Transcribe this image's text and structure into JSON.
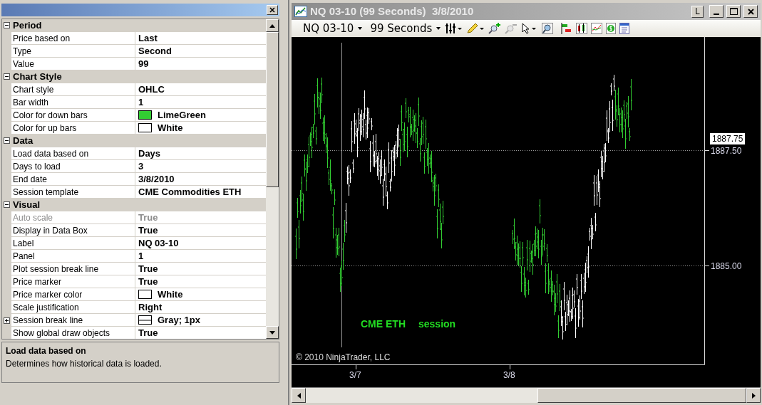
{
  "properties_panel": {
    "categories": [
      {
        "name": "Period",
        "expanded": true,
        "items": [
          {
            "kind": "text",
            "name": "Price based on",
            "value": "Last"
          },
          {
            "kind": "text",
            "name": "Type",
            "value": "Second"
          },
          {
            "kind": "text",
            "name": "Value",
            "value": "99"
          }
        ]
      },
      {
        "name": "Chart Style",
        "expanded": true,
        "items": [
          {
            "kind": "text",
            "name": "Chart style",
            "value": "OHLC"
          },
          {
            "kind": "text",
            "name": "Bar width",
            "value": "1"
          },
          {
            "kind": "color",
            "name": "Color for down bars",
            "value": "LimeGreen",
            "color": "#32cd32"
          },
          {
            "kind": "color",
            "name": "Color for up bars",
            "value": "White",
            "color": "#ffffff"
          }
        ]
      },
      {
        "name": "Data",
        "expanded": true,
        "items": [
          {
            "kind": "text",
            "name": "Load data based on",
            "value": "Days"
          },
          {
            "kind": "text",
            "name": "Days to load",
            "value": "3"
          },
          {
            "kind": "text",
            "name": "End date",
            "value": "3/8/2010"
          },
          {
            "kind": "text",
            "name": "Session template",
            "value": "CME Commodities ETH"
          }
        ]
      },
      {
        "name": "Visual",
        "expanded": true,
        "items": [
          {
            "kind": "text",
            "name": "Auto scale",
            "value": "True",
            "disabled": true
          },
          {
            "kind": "text",
            "name": "Display in Data Box",
            "value": "True"
          },
          {
            "kind": "text",
            "name": "Label",
            "value": "NQ 03-10"
          },
          {
            "kind": "text",
            "name": "Panel",
            "value": "1"
          },
          {
            "kind": "text",
            "name": "Plot session break line",
            "value": "True"
          },
          {
            "kind": "text",
            "name": "Price marker",
            "value": "True"
          },
          {
            "kind": "color",
            "name": "Price marker color",
            "value": "White",
            "color": "#ffffff"
          },
          {
            "kind": "text",
            "name": "Scale justification",
            "value": "Right"
          },
          {
            "kind": "line",
            "name": "Session break line",
            "value": "Gray; 1px",
            "expanded": false
          },
          {
            "kind": "text",
            "name": "Show global draw objects",
            "value": "True"
          }
        ]
      }
    ],
    "description": {
      "title": "Load data based on",
      "text": "Determines how historical data is loaded."
    }
  },
  "chart_window": {
    "title": "NQ 03-10 (99 Seconds)  3/8/2010",
    "link_button": "L",
    "toolbar": {
      "instrument": "NQ 03-10",
      "interval": "99 Seconds"
    },
    "chart": {
      "price_labels": [
        "1887.50",
        "1885.00"
      ],
      "price_marker": "1887.75",
      "date_labels": [
        "3/7",
        "3/8"
      ],
      "session_label": [
        "CME ETH",
        "session"
      ],
      "copyright": "© 2010 NinjaTrader, LLC"
    }
  }
}
